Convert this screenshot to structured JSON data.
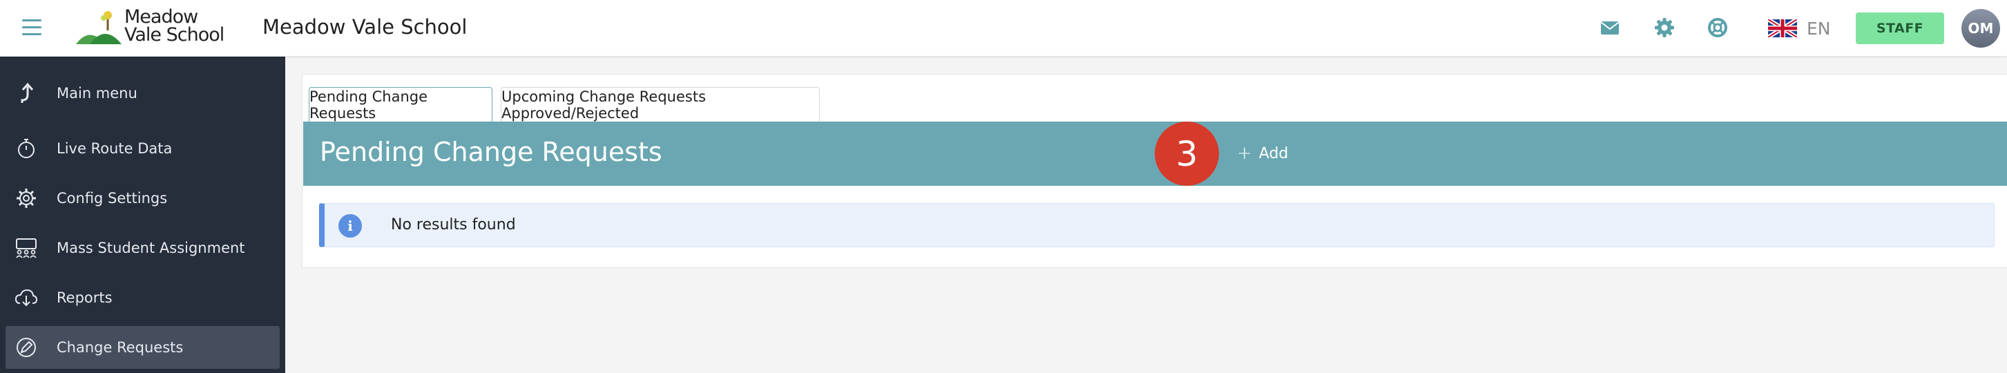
{
  "header": {
    "logo_text": "Meadow\nVale School",
    "school_name": "Meadow Vale School",
    "language_code": "EN",
    "staff_label": "STAFF",
    "user_initials": "OM"
  },
  "colors": {
    "accent": "#6aa7b2",
    "sidebar_bg": "#262d3b",
    "sidebar_active": "#464e5e",
    "staff_badge": "#7fe3a0",
    "step_badge": "#d63a2a",
    "info": "#5b8fe0"
  },
  "sidebar": {
    "items": [
      {
        "label": "Main menu",
        "icon": "arrow-up-icon"
      },
      {
        "label": "Live Route Data",
        "icon": "stopwatch-icon"
      },
      {
        "label": "Config Settings",
        "icon": "gear-icon"
      },
      {
        "label": "Mass Student Assignment",
        "icon": "group-icon"
      },
      {
        "label": "Reports",
        "icon": "cloud-download-icon"
      },
      {
        "label": "Change Requests",
        "icon": "edit-icon",
        "active": true
      }
    ]
  },
  "tabs": [
    {
      "label": "Pending Change Requests",
      "active": true
    },
    {
      "label": "Upcoming Change Requests Approved/Rejected",
      "active": false
    }
  ],
  "panel": {
    "title": "Pending Change Requests",
    "step_number": "3",
    "add_label": "Add",
    "empty_message": "No results found"
  }
}
